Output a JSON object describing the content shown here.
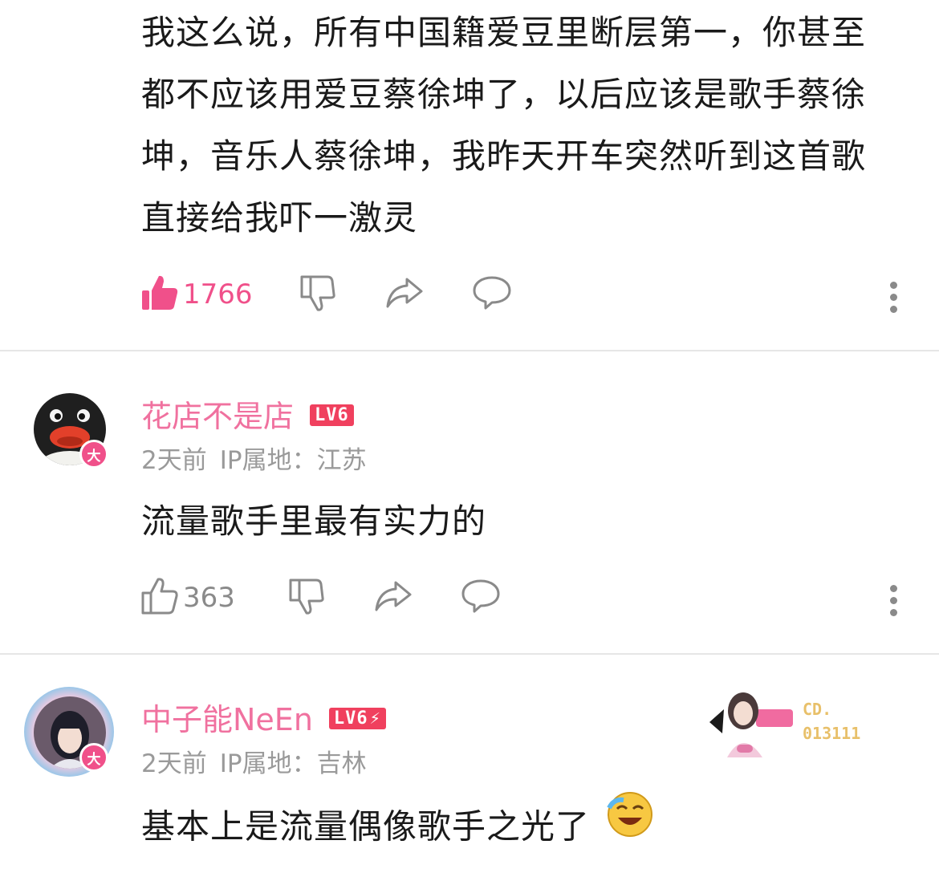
{
  "comments": [
    {
      "text": "我这么说，所有中国籍爱豆里断层第一，你甚至都不应该用爱豆蔡徐坤了，以后应该是歌手蔡徐坤，音乐人蔡徐坤，我昨天开车突然听到这首歌直接给我吓一激灵",
      "likes": "1766",
      "liked": true
    },
    {
      "username": "花店不是店",
      "level": "LV6",
      "time": "2天前",
      "ip_label": "IP属地：江苏",
      "badge": "大",
      "text": "流量歌手里最有实力的",
      "likes": "363",
      "liked": false
    },
    {
      "username": "中子能NeEn",
      "level": "LV6",
      "time": "2天前",
      "ip_label": "IP属地：吉林",
      "badge": "大",
      "decoration_text": [
        "CD.",
        "013111"
      ],
      "text": "基本上是流量偶像歌手之光了"
    }
  ],
  "colors": {
    "accent": "#f0508a",
    "username": "#f0719f",
    "level_badge": "#f0405e",
    "muted": "#9a9a9a",
    "icon": "#8a8a8a"
  },
  "icons": {
    "like": "thumbs-up-icon",
    "dislike": "thumbs-down-icon",
    "share": "share-icon",
    "reply": "reply-icon",
    "more": "more-vertical-icon"
  }
}
